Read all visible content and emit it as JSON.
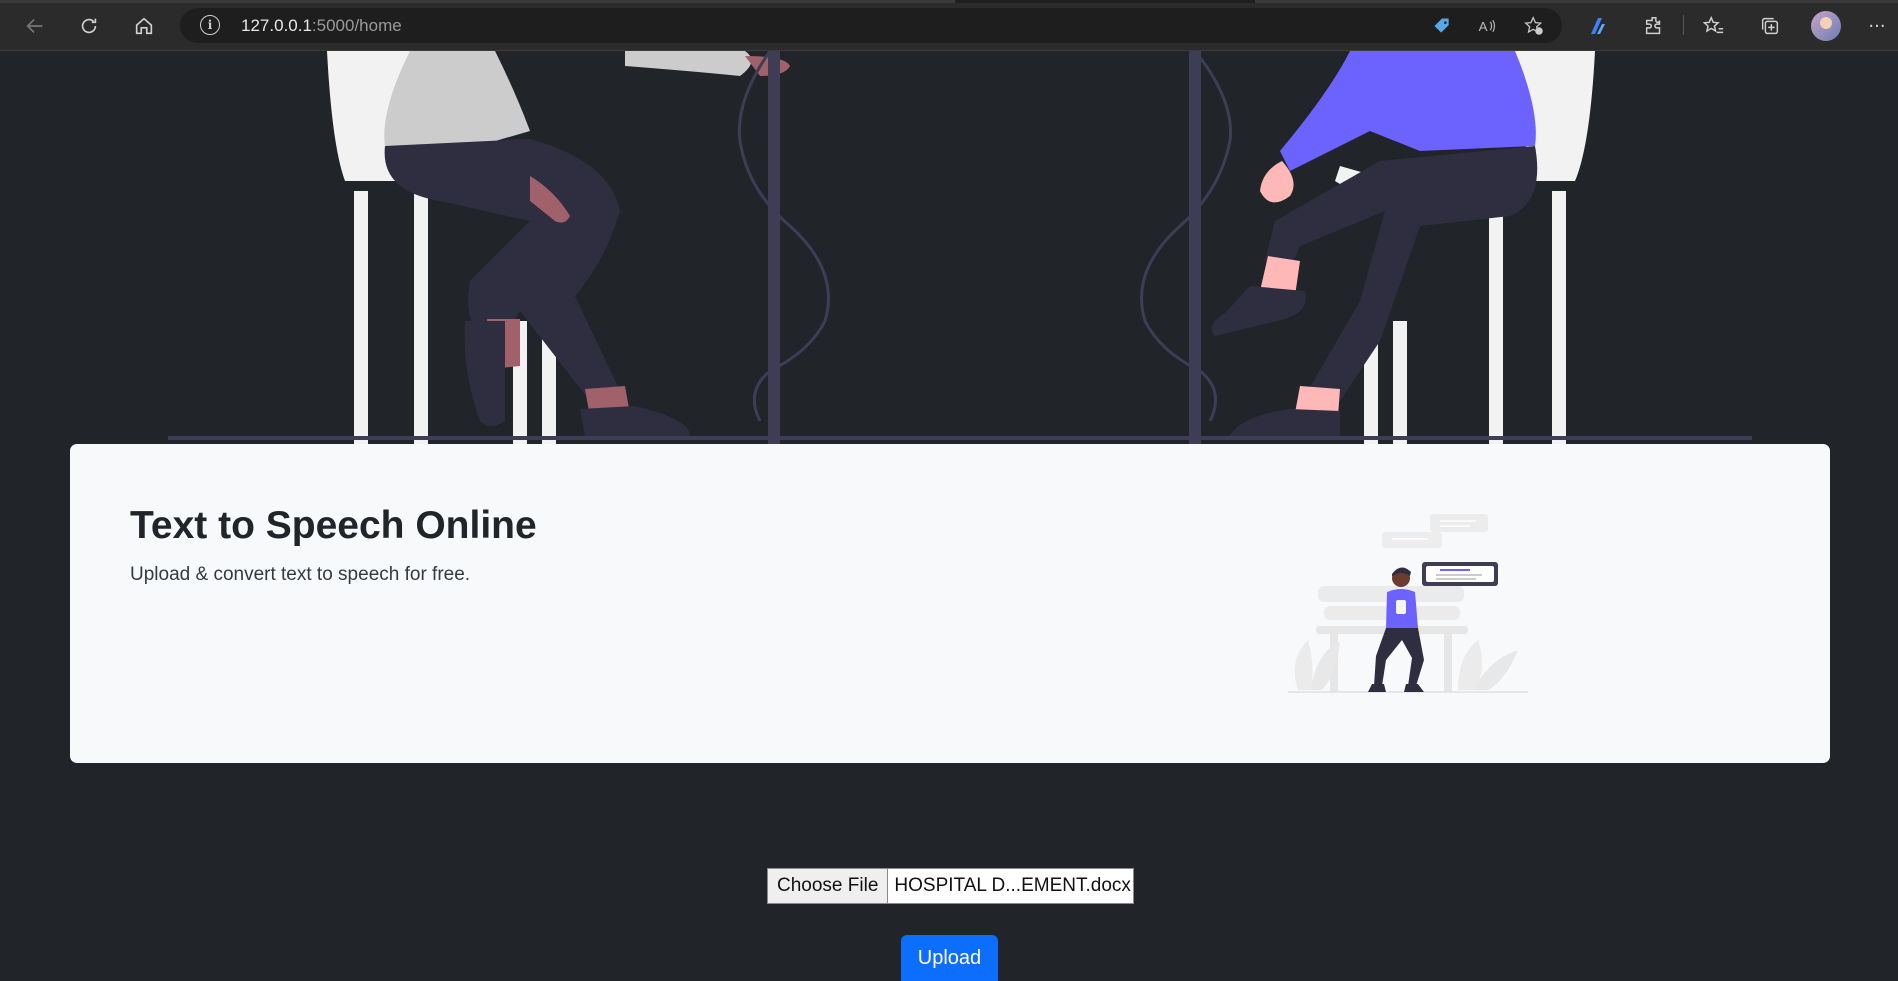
{
  "browser": {
    "url_host": "127.0.0.1",
    "url_rest": ":5000/home",
    "icons": [
      "back-icon",
      "refresh-icon",
      "home-icon",
      "site-info-icon",
      "tag-icon",
      "read-aloud-icon",
      "add-favorite-icon",
      "copilot-icon",
      "extensions-icon",
      "favorites-icon",
      "collections-icon",
      "profile-avatar",
      "more-icon"
    ]
  },
  "card": {
    "title": "Text to Speech Online",
    "subtitle": "Upload & convert text to speech for free."
  },
  "form": {
    "choose_file_label": "Choose File",
    "file_name": "HOSPITAL D...EMENT.docx",
    "upload_label": "Upload"
  },
  "colors": {
    "page_bg": "#212529",
    "card_bg": "#f8f9fa",
    "accent": "#0d6efd",
    "illustration_purple": "#6c63ff",
    "illustration_dark": "#2f2e41"
  }
}
